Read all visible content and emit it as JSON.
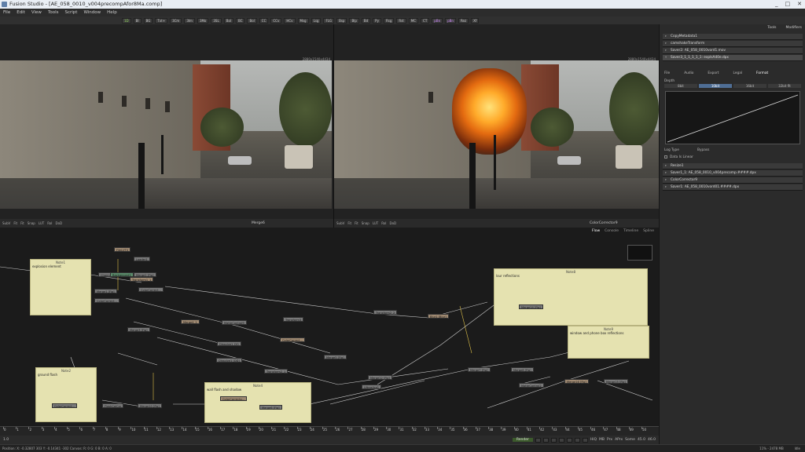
{
  "window": {
    "title": "Fusion Studio - [AE_058_0010_v004precompAfor8Ma.comp]",
    "controls": [
      "_",
      "□",
      "✕"
    ]
  },
  "menu": [
    "File",
    "Edit",
    "View",
    "Tools",
    "Script",
    "Window",
    "Help"
  ],
  "toolbar": [
    {
      "l": "1D",
      "c": "g"
    },
    {
      "l": "BI",
      "c": ""
    },
    {
      "l": "BG",
      "c": ""
    },
    {
      "l": "Txt+",
      "c": ""
    },
    {
      "l": "3Cm",
      "c": ""
    },
    {
      "l": "3Im",
      "c": ""
    },
    {
      "l": "3Mo",
      "c": ""
    },
    {
      "l": "3SL",
      "c": ""
    },
    {
      "l": "Bol",
      "c": ""
    },
    {
      "l": "BC",
      "c": ""
    },
    {
      "l": "Bol",
      "c": ""
    },
    {
      "l": "CC",
      "c": ""
    },
    {
      "l": "CCv",
      "c": ""
    },
    {
      "l": "HCv",
      "c": ""
    },
    {
      "l": "Msg",
      "c": ""
    },
    {
      "l": "Lsg",
      "c": ""
    },
    {
      "l": "FLG",
      "c": ""
    },
    {
      "l": "Bsp",
      "c": ""
    },
    {
      "l": "Blp",
      "c": ""
    },
    {
      "l": "Bd",
      "c": ""
    },
    {
      "l": "Py",
      "c": ""
    },
    {
      "l": "Rsg",
      "c": ""
    },
    {
      "l": "Rst",
      "c": ""
    },
    {
      "l": "MC",
      "c": ""
    },
    {
      "l": "CT",
      "c": ""
    },
    {
      "l": "pBn",
      "c": "p"
    },
    {
      "l": "pBn",
      "c": "p"
    },
    {
      "l": "Rez",
      "c": ""
    },
    {
      "l": "Xf",
      "c": ""
    }
  ],
  "viewers": {
    "left_info": "2880x1540x4434",
    "right_info": "2880x1540x4434",
    "left_label": "Merge6",
    "right_label": "ColorCorrector9"
  },
  "viewer_bar": [
    "SubV",
    "Fit",
    "Fit",
    "LUT",
    "RoI",
    "DoD",
    "Snap"
  ],
  "flow": {
    "tabs": [
      "Flow",
      "Console",
      "Timeline",
      "Spline"
    ],
    "notes": [
      {
        "title": "Note1",
        "text": "explosion element"
      },
      {
        "title": "Note2",
        "text": "ground flash"
      },
      {
        "title": "Note4",
        "text": "wall flash and shadow"
      },
      {
        "title": "Note8",
        "text": "lour reflections"
      },
      {
        "title": "Note9",
        "text": "window and phone box reflections"
      }
    ],
    "nodes": [
      "FileLUT4",
      "Loader1",
      "Merge1 [Fig]",
      "ColorCorrect...",
      "ChannelBool...",
      "Transform1_1",
      "ColorCorrect...",
      "Background1",
      "Merge2 [Fig]",
      "Merge3 [Fig]",
      "Merge4_1",
      "MatteControl9",
      "Dissolve1_DO",
      "Dissolve1 [DD]",
      "Transform3",
      "ColorCorrect...",
      "Merge5 [Fig]",
      "Transform2_1",
      "Ultraslice1",
      "Merge12 [Fig]",
      "Blur1 [Blur]",
      "Merge7 [Fig]",
      "Merge8 [Fig]",
      "Merge14 [Fig]",
      "Merge15 [Fig]",
      "Merge16 [Fig]",
      "Merge6 [Fig]",
      "ColorCorrect...",
      "FlashColCor",
      "Merge10 [Fig]",
      "ColorCorrecto...",
      "MatteControl2",
      "Transform2_2"
    ]
  },
  "timeline": {
    "ticks": [
      "0",
      "1",
      "2",
      "3",
      "4",
      "5",
      "6",
      "7",
      "8",
      "9",
      "10",
      "11",
      "12",
      "13",
      "14",
      "15",
      "16",
      "17",
      "18",
      "19",
      "20",
      "21",
      "22",
      "23",
      "24",
      "25",
      "26",
      "27",
      "28",
      "29",
      "30",
      "31",
      "32",
      "33",
      "34",
      "35",
      "36",
      "37",
      "38",
      "39",
      "40",
      "41",
      "42",
      "43",
      "44",
      "45",
      "46",
      "47",
      "48",
      "49",
      "50"
    ],
    "start": "1.0",
    "end": "46.0",
    "render": "Render",
    "current": "45.0"
  },
  "transport": {
    "modes": [
      "HiQ",
      "MB",
      "Prx",
      "APrx",
      "Some"
    ],
    "fps": "46.0"
  },
  "status": {
    "position": "Position:  X: -0.32807   303   Y: -0.14341  -302  Canvas: R: 0  G: 0  B: 0  A: 0",
    "memory": "11% - 2478 MB",
    "idle": "Idle"
  },
  "right_panel": {
    "tabs": [
      "Tools",
      "Modifiers"
    ],
    "tools": [
      "CopyMetadata1",
      "camshakeTransform",
      "Saver2: AE_058_0010vord1.mov",
      "Saver3_1_1_1_1_1: explsA40e.dpx"
    ],
    "saver_tabs": [
      "File",
      "Audio",
      "Export",
      "Legal",
      "Format"
    ],
    "depth_label": "Depth",
    "depth_opts": [
      "8bit",
      "10bit",
      "16bit",
      "32bit flt"
    ],
    "log_type_label": "Log Type",
    "log_type": "Bypass",
    "linear_label": "Data Is Linear",
    "tools2": [
      "Resize1",
      "Saver1_1: AE_058_0010_v004precomp.####.dpx",
      "ColorCorrector9",
      "Saver1: AE_058_0010vord01.####.dpx"
    ]
  }
}
